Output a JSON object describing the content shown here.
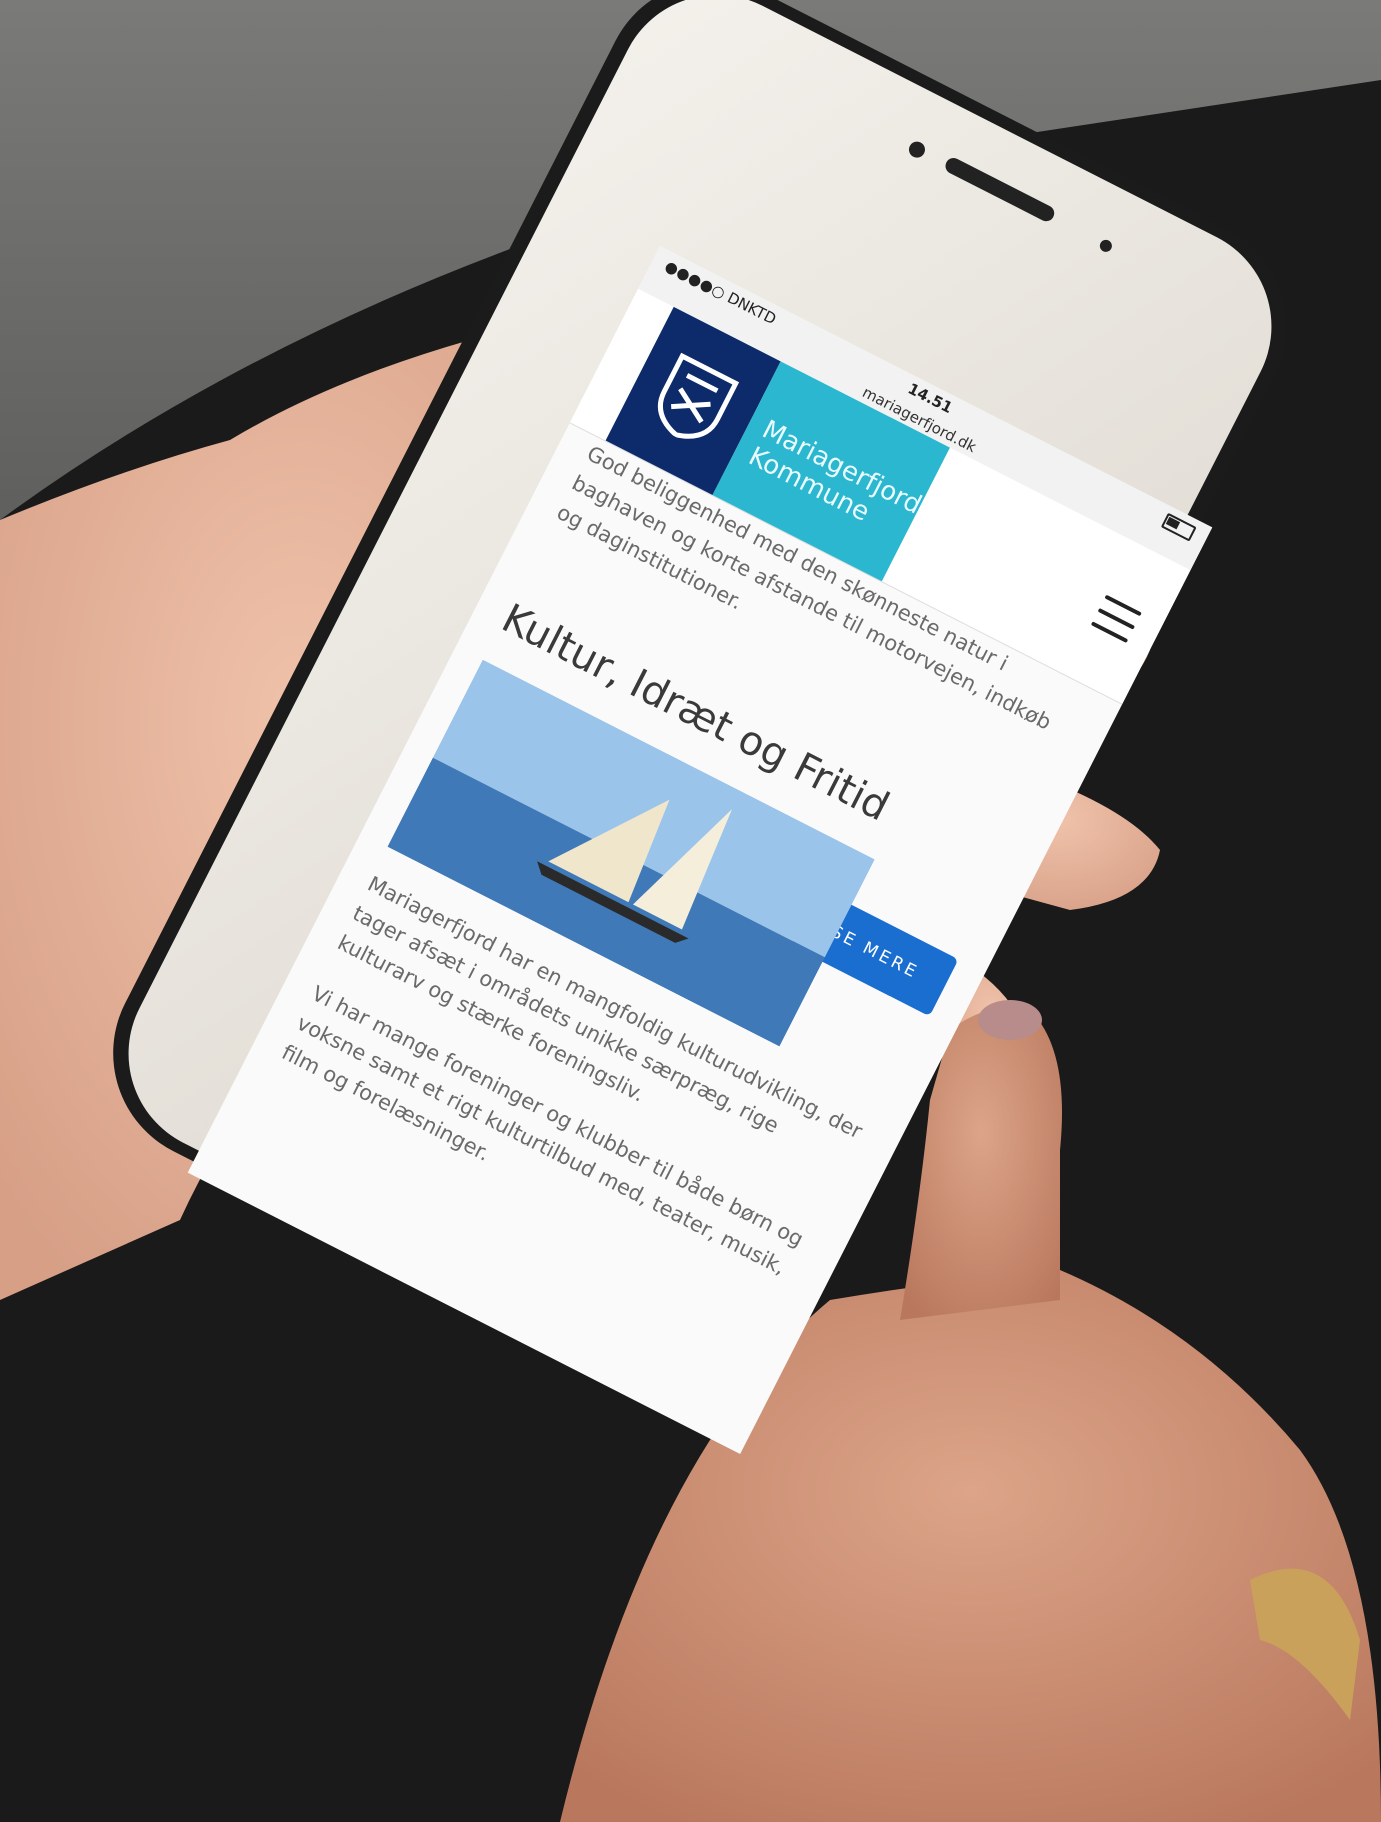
{
  "statusbar": {
    "carrier": "●●●●○ DNKTD",
    "time": "14.51",
    "url": "mariagerfjord.dk"
  },
  "header": {
    "logo_line1": "Mariagerfjord",
    "logo_line2": "Kommune"
  },
  "page": {
    "intro": "God beliggenhed med den skønneste natur i baghaven og korte afstande til motorvejen, indkøb og daginstitutioner.",
    "section_title": "Kultur, Idræt og Fritid",
    "see_more": "SE MERE",
    "paragraph1": "Mariagerfjord har en mangfoldig kulturudvikling, der tager afsæt i områdets unikke særpræg, rige kulturarv og stærke foreningsliv.",
    "paragraph2": "Vi har mange foreninger og klubber til både børn og voksne samt et rigt kulturtilbud med, teater, musik, film og forelæsninger."
  },
  "colors": {
    "logo_dark": "#0d2a6b",
    "logo_teal": "#2bb7cf",
    "button_blue": "#1a6ed0",
    "phone_body": "#eeeae3",
    "background_top": "#6f6f6d",
    "background_bottom": "#151515"
  },
  "icons": [
    "shield-logo-icon",
    "menu-icon",
    "home-button-icon"
  ]
}
